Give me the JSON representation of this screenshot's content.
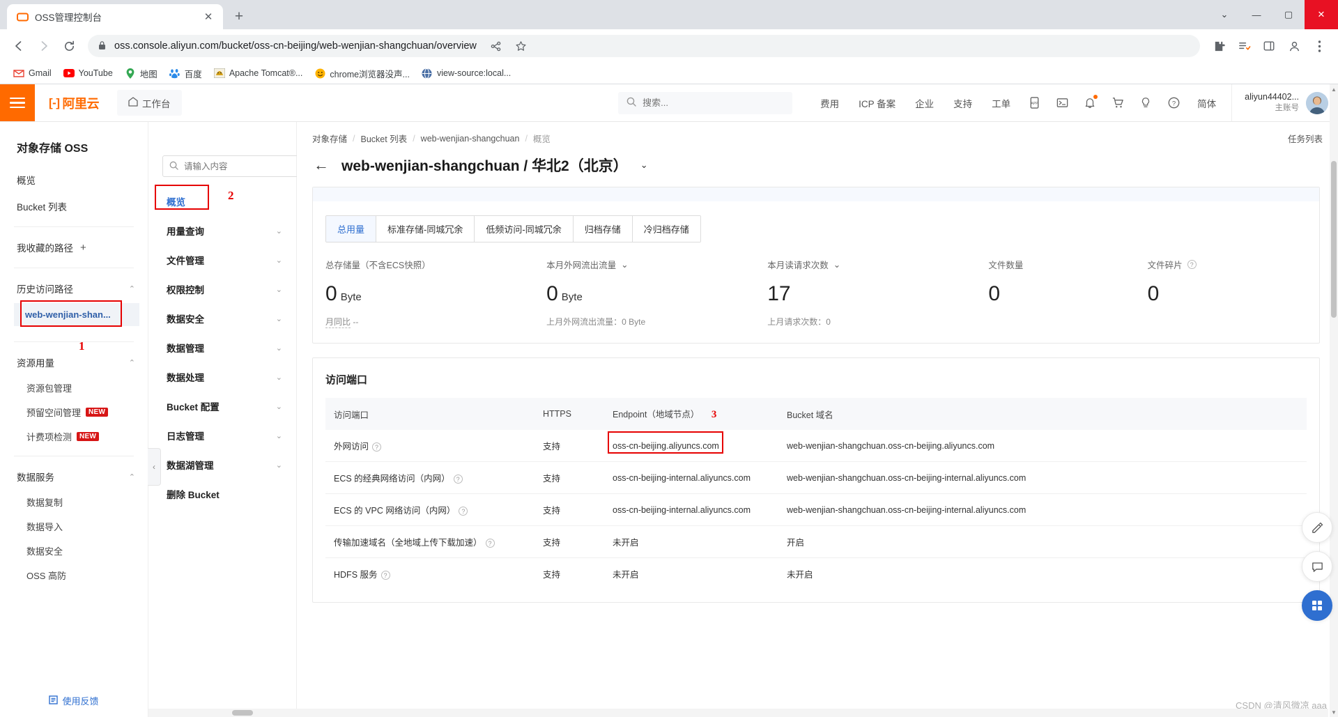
{
  "browser": {
    "tab": {
      "title": "OSS管理控制台",
      "favicon": "aliyun-icon",
      "close_label": "✕"
    },
    "new_tab_label": "+",
    "window_controls": {
      "minimize": "—",
      "maximize": "▢",
      "close": "✕",
      "chevron": "⌄"
    },
    "nav": {
      "back": "←",
      "forward": "→",
      "reload": "⟳",
      "lock": "🔒"
    },
    "url": "oss.console.aliyun.com/bucket/oss-cn-beijing/web-wenjian-shangchuan/overview",
    "omnibox_icons": [
      "share-icon",
      "star-icon",
      "extensions-icon",
      "readinglist-icon",
      "sidepanel-icon",
      "profile-icon",
      "menu-icon"
    ],
    "bookmarks": [
      {
        "label": "Gmail",
        "icon": "M"
      },
      {
        "label": "YouTube",
        "icon": "▶"
      },
      {
        "label": "地图",
        "icon": "◉"
      },
      {
        "label": "百度",
        "icon": "熊"
      },
      {
        "label": "Apache Tomcat®...",
        "icon": "🐱"
      },
      {
        "label": "chrome浏览器没声...",
        "icon": "☺"
      },
      {
        "label": "view-source:local...",
        "icon": "◑"
      }
    ]
  },
  "header": {
    "logo": "阿里云",
    "workbench": "工作台",
    "search_placeholder": "搜索...",
    "nav_items": [
      "费用",
      "ICP 备案",
      "企业",
      "支持",
      "工单"
    ],
    "icons": [
      "app-icon",
      "terminal-icon",
      "bell-icon",
      "cart-icon",
      "bulb-icon",
      "help-icon"
    ],
    "language": "简体",
    "account_name": "aliyun44402...",
    "account_role": "主账号"
  },
  "sidebar": {
    "title": "对象存储 OSS",
    "items": [
      {
        "label": "概览"
      },
      {
        "label": "Bucket 列表"
      }
    ],
    "favorites_group": {
      "label": "我收藏的路径",
      "add": "+"
    },
    "history_group": {
      "label": "历史访问路径",
      "chevron": "⌃",
      "item": "web-wenjian-shan...",
      "annotation": "1"
    },
    "usage_group": {
      "label": "资源用量",
      "chevron": "⌃",
      "items": [
        {
          "label": "资源包管理",
          "badge": ""
        },
        {
          "label": "预留空间管理",
          "badge": "NEW"
        },
        {
          "label": "计费项检测",
          "badge": "NEW"
        }
      ]
    },
    "data_group": {
      "label": "数据服务",
      "chevron": "⌃",
      "items": [
        {
          "label": "数据复制"
        },
        {
          "label": "数据导入"
        },
        {
          "label": "数据安全"
        },
        {
          "label": "OSS 高防"
        }
      ]
    },
    "feedback": "使用反馈"
  },
  "bucket_menu": {
    "search_placeholder": "请输入内容",
    "star_icon": "☆",
    "annotation": "2",
    "items": [
      {
        "label": "概览",
        "active": true,
        "chevron": ""
      },
      {
        "label": "用量查询",
        "active": false,
        "chevron": "⌄"
      },
      {
        "label": "文件管理",
        "active": false,
        "chevron": "⌄"
      },
      {
        "label": "权限控制",
        "active": false,
        "chevron": "⌄"
      },
      {
        "label": "数据安全",
        "active": false,
        "chevron": "⌄"
      },
      {
        "label": "数据管理",
        "active": false,
        "chevron": "⌄"
      },
      {
        "label": "数据处理",
        "active": false,
        "chevron": "⌄"
      },
      {
        "label": "Bucket 配置",
        "active": false,
        "chevron": "⌄"
      },
      {
        "label": "日志管理",
        "active": false,
        "chevron": "⌄"
      },
      {
        "label": "数据湖管理",
        "active": false,
        "chevron": "⌄"
      },
      {
        "label": "删除 Bucket",
        "active": false,
        "chevron": ""
      }
    ],
    "collapse_icon": "‹"
  },
  "main": {
    "breadcrumb": [
      "对象存储",
      "Bucket 列表",
      "web-wenjian-shangchuan",
      "概览"
    ],
    "breadcrumb_sep": "/",
    "task_list": "任务列表",
    "back_arrow": "←",
    "bucket_name": "web-wenjian-shangchuan",
    "title_sep": "/",
    "region": "华北2（北京）",
    "title_caret": "⌄",
    "storage_tabs": [
      {
        "label": "总用量",
        "selected": true
      },
      {
        "label": "标准存储-同城冗余",
        "selected": false
      },
      {
        "label": "低频访问-同城冗余",
        "selected": false
      },
      {
        "label": "归档存储",
        "selected": false
      },
      {
        "label": "冷归档存储",
        "selected": false
      }
    ],
    "metrics": [
      {
        "label": "总存储量（不含ECS快照）",
        "caret": "",
        "value": "0",
        "unit": "Byte",
        "sub_label": "月同比",
        "sub_value": "--"
      },
      {
        "label": "本月外网流出流量",
        "caret": "⌄",
        "value": "0",
        "unit": "Byte",
        "sub_label": "上月外网流出流量：",
        "sub_value": "0 Byte"
      },
      {
        "label": "本月读请求次数",
        "caret": "⌄",
        "value": "17",
        "unit": "",
        "sub_label": "上月请求次数：",
        "sub_value": "0"
      },
      {
        "label": "文件数量",
        "caret": "",
        "value": "0",
        "unit": "",
        "sub_label": "",
        "sub_value": ""
      },
      {
        "label": "文件碎片",
        "caret": "",
        "help": "?",
        "value": "0",
        "unit": "",
        "sub_label": "",
        "sub_value": ""
      }
    ],
    "endpoint_section": {
      "title": "访问端口",
      "annotation": "3",
      "columns": [
        "访问端口",
        "HTTPS",
        "Endpoint（地域节点）",
        "Bucket 域名"
      ],
      "rows": [
        {
          "port": "外网访问",
          "help": "?",
          "https": "支持",
          "endpoint": "oss-cn-beijing.aliyuncs.com",
          "domain": "web-wenjian-shangchuan.oss-cn-beijing.aliyuncs.com",
          "highlight": true,
          "domain_link": false
        },
        {
          "port": "ECS 的经典网络访问（内网）",
          "help": "?",
          "https": "支持",
          "endpoint": "oss-cn-beijing-internal.aliyuncs.com",
          "domain": "web-wenjian-shangchuan.oss-cn-beijing-internal.aliyuncs.com",
          "highlight": false,
          "domain_link": false
        },
        {
          "port": "ECS 的 VPC 网络访问（内网）",
          "help": "?",
          "https": "支持",
          "endpoint": "oss-cn-beijing-internal.aliyuncs.com",
          "domain": "web-wenjian-shangchuan.oss-cn-beijing-internal.aliyuncs.com",
          "highlight": false,
          "domain_link": false
        },
        {
          "port": "传输加速域名（全地域上传下载加速）",
          "help": "?",
          "https": "支持",
          "endpoint": "未开启",
          "domain": "开启",
          "highlight": false,
          "domain_link": true
        },
        {
          "port": "HDFS 服务",
          "help": "?",
          "https": "支持",
          "endpoint": "未开启",
          "domain": "未开启",
          "highlight": false,
          "domain_link": false
        }
      ]
    },
    "rail_icons": [
      "edit-icon",
      "chat-icon",
      "apps-icon"
    ],
    "watermark": "CSDN @清风微凉 aaa"
  }
}
